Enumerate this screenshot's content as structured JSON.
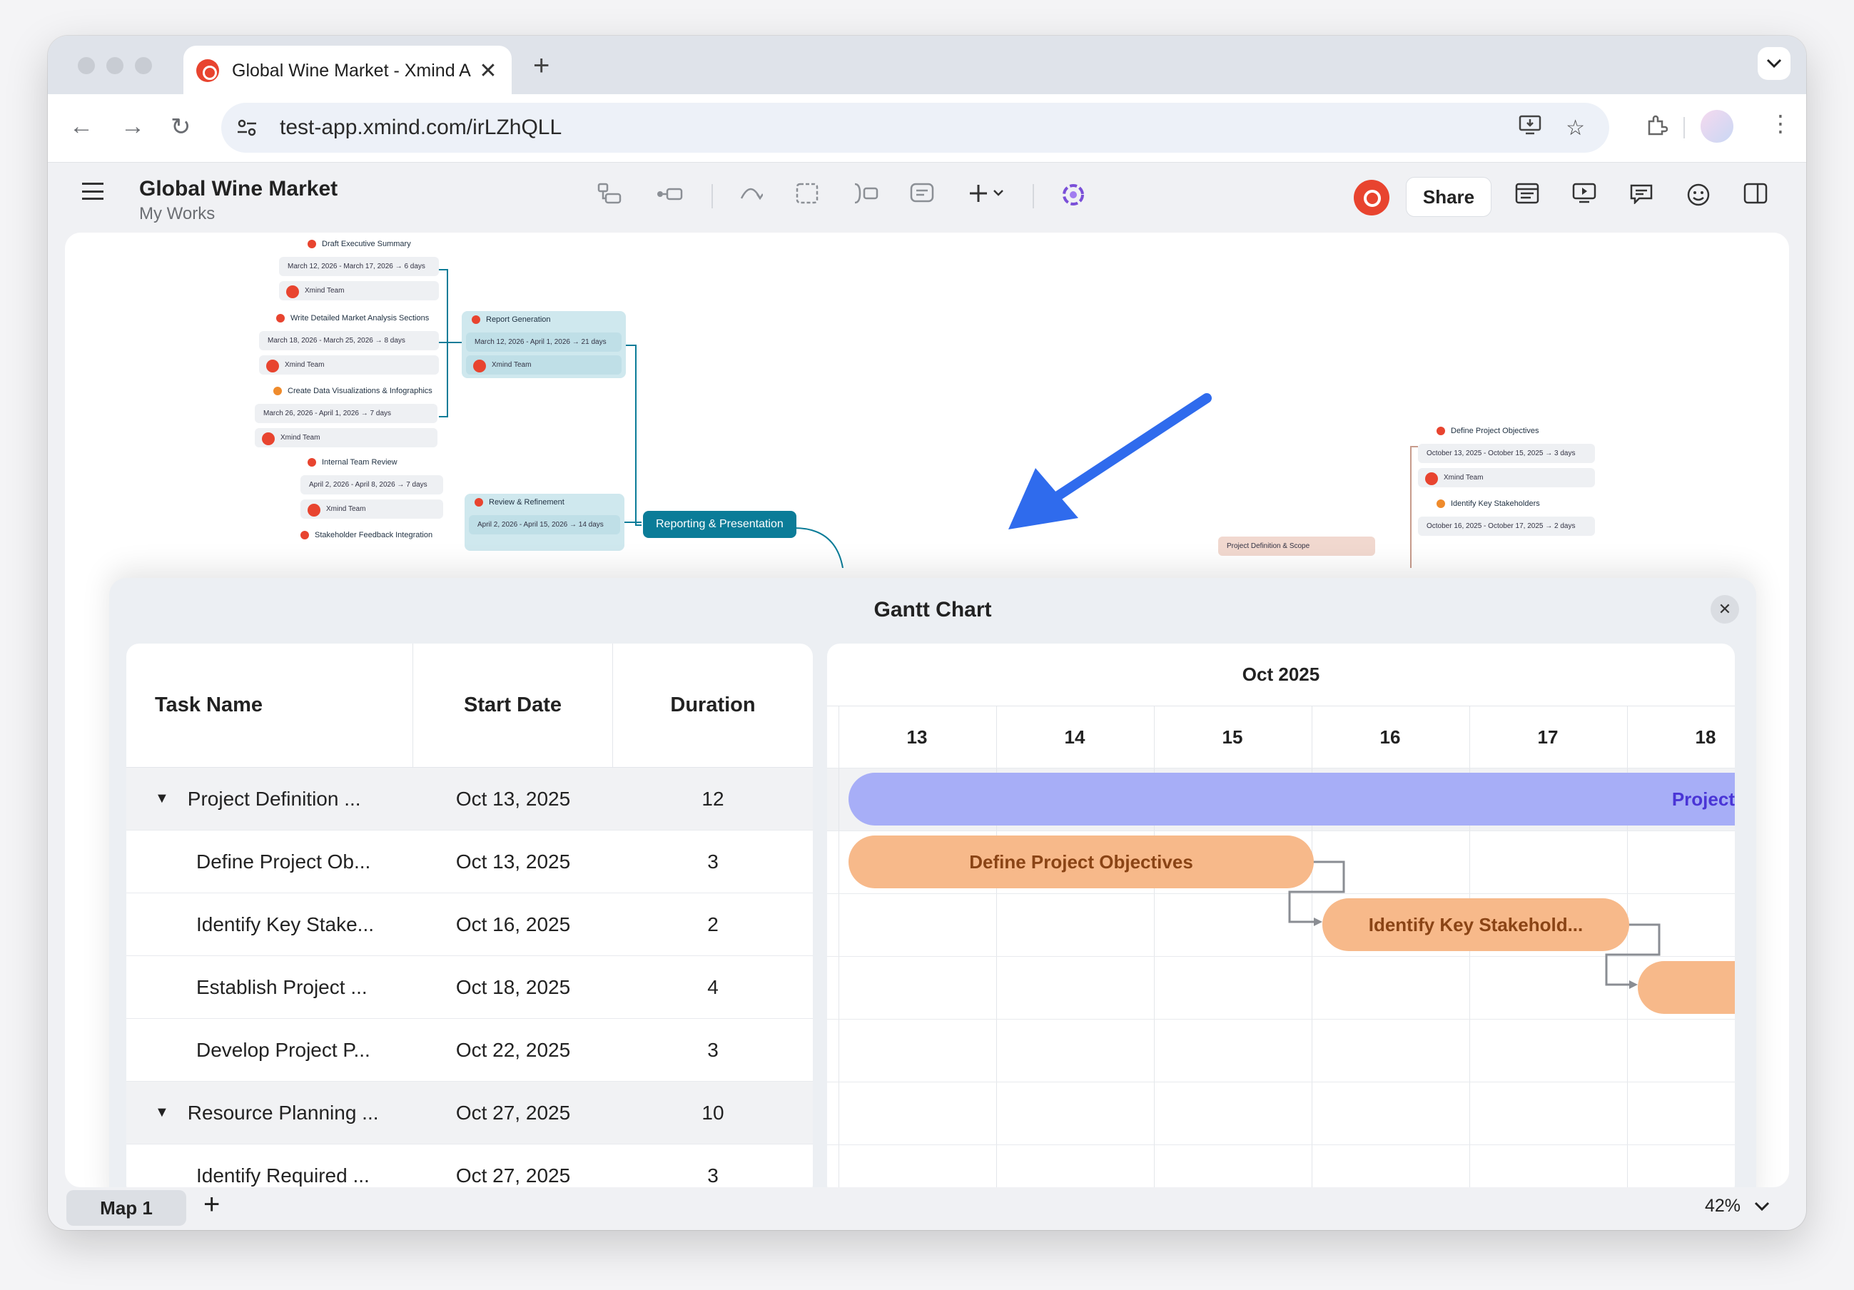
{
  "browser": {
    "tab_title": "Global Wine Market - Xmind A",
    "url": "test-app.xmind.com/irLZhQLL",
    "tab_close": "✕",
    "new_tab": "+",
    "tab_menu": "⌄"
  },
  "app": {
    "doc_title": "Global Wine Market",
    "doc_subtitle": "My Works",
    "share_label": "Share"
  },
  "mindmap": {
    "central": "Reporting & Presentation",
    "left_nodes": [
      {
        "label": "Draft Executive Summary",
        "date": "March 12, 2026 - March 17, 2026",
        "days": "6 days",
        "team": "Xmind Team"
      },
      {
        "label": "Write Detailed Market Analysis Sections",
        "date": "March 18, 2026 - March 25, 2026",
        "days": "8 days",
        "team": "Xmind Team"
      },
      {
        "label": "Create Data Visualizations & Infographics",
        "date": "March 26, 2026 - April 1, 2026",
        "days": "7 days",
        "team": "Xmind Team"
      },
      {
        "label": "Internal Team Review",
        "date": "April 2, 2026 - April 8, 2026",
        "days": "7 days",
        "team": "Xmind Team"
      },
      {
        "label": "Stakeholder Feedback Integration",
        "date": "",
        "days": "",
        "team": ""
      }
    ],
    "groups": [
      {
        "label": "Report Generation",
        "date": "March 12, 2026 - April 1, 2026",
        "days": "21 days",
        "team": "Xmind Team"
      },
      {
        "label": "Review & Refinement",
        "date": "April 2, 2026 - April 15, 2026",
        "days": "14 days"
      }
    ],
    "right_nodes": [
      {
        "label": "Define Project Objectives",
        "date": "October 13, 2025 - October 15, 2025",
        "days": "3 days",
        "team": "Xmind Team"
      },
      {
        "label": "Identify Key Stakeholders",
        "date": "October 16, 2025 - October 17, 2025",
        "days": "2 days"
      }
    ],
    "partial_node": "Project Definition & Scope"
  },
  "gantt": {
    "title": "Gantt Chart",
    "close": "✕",
    "columns": {
      "name": "Task Name",
      "start": "Start Date",
      "duration": "Duration"
    },
    "rows": [
      {
        "name": "Project Definition ...",
        "start": "Oct 13, 2025",
        "duration": "12",
        "parent": true
      },
      {
        "name": "Define Project Ob...",
        "start": "Oct 13, 2025",
        "duration": "3",
        "parent": false
      },
      {
        "name": "Identify Key Stake...",
        "start": "Oct 16, 2025",
        "duration": "2",
        "parent": false
      },
      {
        "name": "Establish Project ...",
        "start": "Oct 18, 2025",
        "duration": "4",
        "parent": false
      },
      {
        "name": "Develop Project P...",
        "start": "Oct 22, 2025",
        "duration": "3",
        "parent": false
      },
      {
        "name": "Resource Planning ...",
        "start": "Oct 27, 2025",
        "duration": "10",
        "parent": true
      },
      {
        "name": "Identify Required ...",
        "start": "Oct 27, 2025",
        "duration": "3",
        "parent": false
      }
    ],
    "month": "Oct 2025",
    "days": [
      "13",
      "14",
      "15",
      "16",
      "17",
      "18"
    ],
    "bars": {
      "parent_label": "Project",
      "bar1_label": "Define Project Objectives",
      "bar2_label": "Identify Key Stakehold..."
    }
  },
  "bottom": {
    "sheet_tab": "Map 1",
    "add_sheet": "+",
    "zoom": "42%"
  },
  "colors": {
    "accent": "#0b7c98",
    "brand": "#e8442f",
    "gantt_parent_bar": "#a7aef7",
    "gantt_child_bar": "#f7b98a",
    "annotation_arrow": "#2f6bed"
  }
}
